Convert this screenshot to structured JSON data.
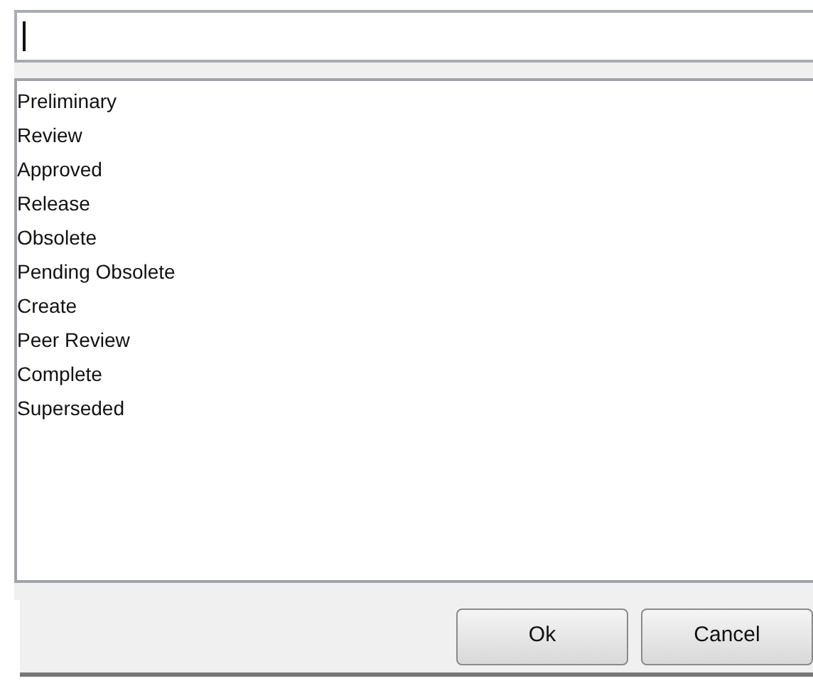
{
  "list": {
    "items": [
      {
        "label": "Preliminary"
      },
      {
        "label": "Review"
      },
      {
        "label": "Approved"
      },
      {
        "label": "Release"
      },
      {
        "label": "Obsolete"
      },
      {
        "label": "Pending Obsolete"
      },
      {
        "label": "Create"
      },
      {
        "label": "Peer Review"
      },
      {
        "label": "Complete"
      },
      {
        "label": "Superseded"
      }
    ]
  },
  "buttons": [
    {
      "label": "Ok"
    },
    {
      "label": "Cancel"
    }
  ]
}
